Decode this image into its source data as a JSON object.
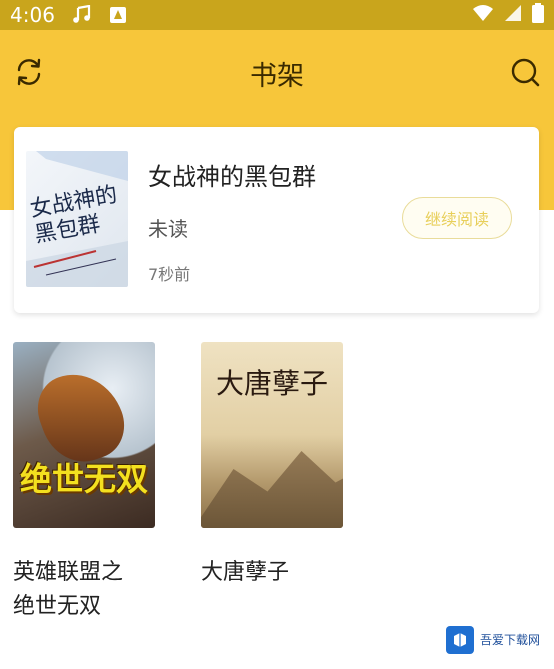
{
  "status_bar": {
    "time": "4:06"
  },
  "toolbar": {
    "title": "书架"
  },
  "recent": {
    "cover_text": "女战神的黑包群",
    "book_title": "女战神的黑包群",
    "read_status": "未读",
    "time_ago": "7秒前",
    "continue_label": "继续阅读"
  },
  "shelf": [
    {
      "name": "英雄联盟之\n绝世无双",
      "cover_text": "绝世无双"
    },
    {
      "name": "大唐孽子",
      "cover_text": "大唐孽子"
    }
  ],
  "watermark": {
    "text": "吾爱下载网"
  },
  "colors": {
    "status_bar": "#c9a51c",
    "header": "#f7c63a",
    "accent_button": "#e8cf5a"
  }
}
